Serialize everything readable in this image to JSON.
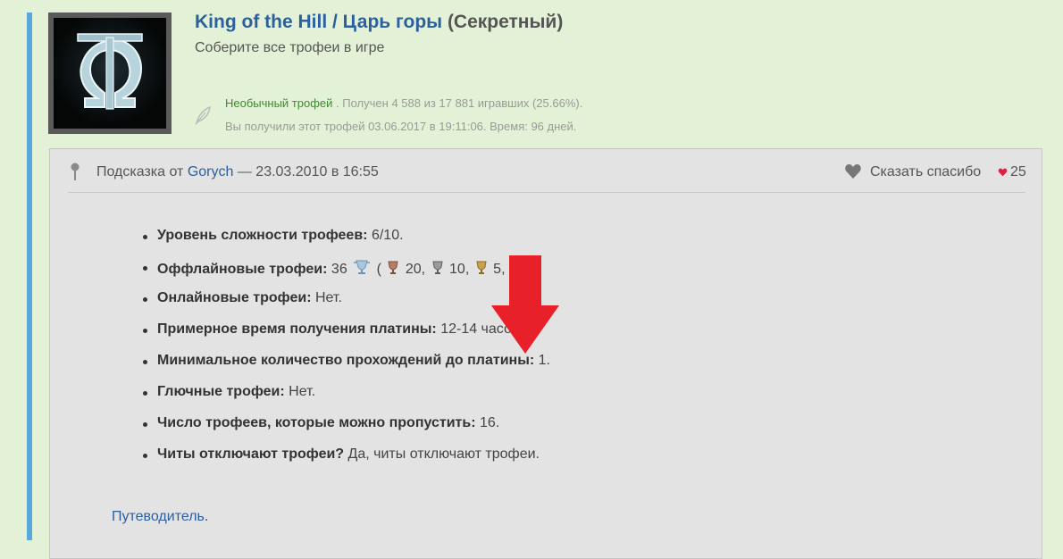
{
  "trophy": {
    "title_link": "King of the Hill / Царь горы",
    "secret_label": "(Секретный)",
    "description": "Соберите все трофеи в игре",
    "rarity": "Необычный трофей",
    "stats": ". Получен 4 588 из 17 881 игравших (25.66%).",
    "earned": "Вы получили этот трофей 03.06.2017 в 19:11:06. Время: 96 дней."
  },
  "hint": {
    "prefix": "Подсказка от",
    "author": "Gorych",
    "date": "— 23.03.2010 в 16:55",
    "thanks_label": "Сказать спасибо",
    "likes": "25",
    "facts": [
      {
        "key": "Уровень сложности трофеев:",
        "value": "6/10."
      },
      {
        "key": "Оффлайновые трофеи:",
        "value": "36"
      },
      {
        "key": "Онлайновые трофеи:",
        "value": "Нет."
      },
      {
        "key": "Примерное время получения платины:",
        "value": "12-14 часов."
      },
      {
        "key": "Минимальное количество прохождений до платины:",
        "value": "1."
      },
      {
        "key": "Глючные трофеи:",
        "value": "Нет."
      },
      {
        "key": "Число трофеев, которые можно пропустить:",
        "value": "16."
      },
      {
        "key": "Читы отключают трофеи?",
        "value": "Да, читы отключают трофеи."
      }
    ],
    "offline_breakdown": {
      "open_paren": "(",
      "bronze": "20,",
      "silver": "10,",
      "gold": "5,"
    },
    "guide_link": "Путеводитель",
    "guide_dot": "."
  },
  "colors": {
    "background": "#e3f2d6",
    "accent_bar": "#5aa7dc",
    "link": "#2b5f9e",
    "rarity": "#3e8a32",
    "arrow": "#e8202a"
  }
}
